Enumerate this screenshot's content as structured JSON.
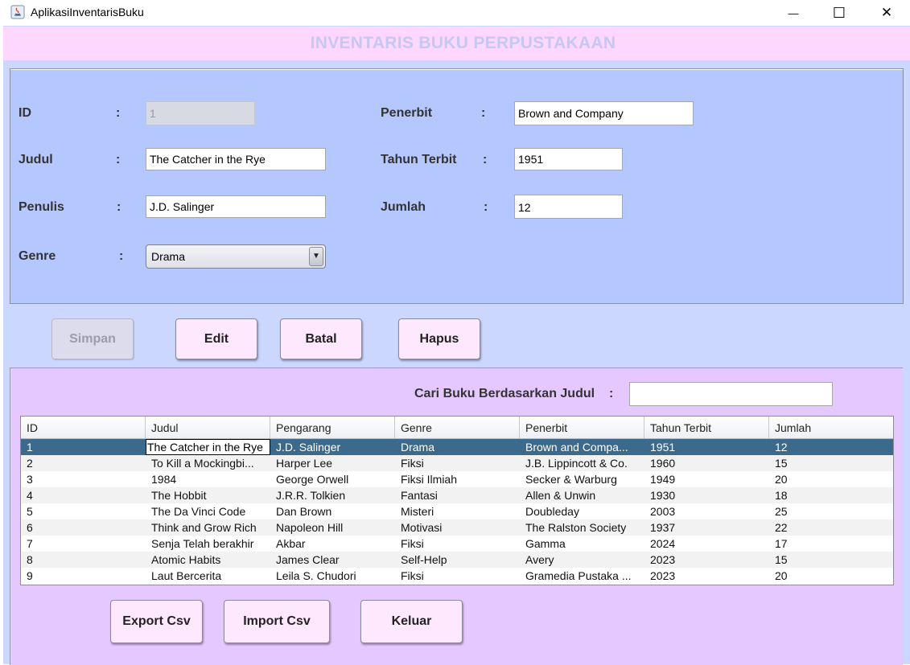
{
  "window": {
    "title": "AplikasiInventarisBuku",
    "minimize_glyph": "—",
    "maximize_glyph": "☐",
    "close_glyph": "✕"
  },
  "header": {
    "title": "INVENTARIS BUKU PERPUSTAKAAN"
  },
  "form": {
    "colon": ":",
    "id": {
      "label": "ID",
      "value": "1"
    },
    "judul": {
      "label": "Judul",
      "value": "The Catcher in the Rye"
    },
    "penulis": {
      "label": "Penulis",
      "value": "J.D. Salinger"
    },
    "genre": {
      "label": "Genre",
      "value": "Drama",
      "arrow_glyph": "▼"
    },
    "penerbit": {
      "label": "Penerbit",
      "value": "Brown and Company"
    },
    "tahun": {
      "label": "Tahun Terbit",
      "value": "1951"
    },
    "jumlah": {
      "label": "Jumlah",
      "value": "12"
    }
  },
  "actions": {
    "simpan": "Simpan",
    "edit": "Edit",
    "batal": "Batal",
    "hapus": "Hapus"
  },
  "search": {
    "label": "Cari Buku Berdasarkan Judul",
    "colon": ":",
    "value": ""
  },
  "table": {
    "columns": [
      "ID",
      "Judul",
      "Pengarang",
      "Genre",
      "Penerbit",
      "Tahun Terbit",
      "Jumlah"
    ],
    "rows": [
      [
        "1",
        "The Catcher in the Rye",
        "J.D. Salinger",
        "Drama",
        "Brown and Compa...",
        "1951",
        "12"
      ],
      [
        "2",
        "To Kill a Mockingbi...",
        "Harper Lee",
        "Fiksi",
        "J.B. Lippincott & Co.",
        "1960",
        "15"
      ],
      [
        "3",
        "1984",
        "George Orwell",
        "Fiksi Ilmiah",
        "Secker & Warburg",
        "1949",
        "20"
      ],
      [
        "4",
        "The Hobbit",
        "J.R.R. Tolkien",
        "Fantasi",
        "Allen & Unwin",
        "1930",
        "18"
      ],
      [
        "5",
        "The Da Vinci Code",
        "Dan Brown",
        "Misteri",
        "Doubleday",
        "2003",
        "25"
      ],
      [
        "6",
        "Think and Grow Rich",
        "Napoleon Hill",
        "Motivasi",
        "The Ralston Society",
        "1937",
        "22"
      ],
      [
        "7",
        "Senja Telah berakhir",
        "Akbar",
        "Fiksi",
        "Gamma",
        "2024",
        "17"
      ],
      [
        "8",
        "Atomic Habits",
        "James Clear",
        "Self-Help",
        "Avery",
        "2023",
        "15"
      ],
      [
        "9",
        "Laut Bercerita",
        "Leila S. Chudori",
        "Fiksi",
        "Gramedia Pustaka ...",
        "2023",
        "20"
      ]
    ],
    "selected_row": 0
  },
  "bottom_actions": {
    "export": "Export Csv",
    "import": "Import Csv",
    "keluar": "Keluar"
  },
  "colors": {
    "header_band": "#fdd7fd",
    "header_text": "#c5c8f2",
    "form_panel": "#b4c7ff",
    "table_panel": "#e5c8ff",
    "button_bg": "#fde8fd",
    "selection": "#3b6a8c"
  }
}
